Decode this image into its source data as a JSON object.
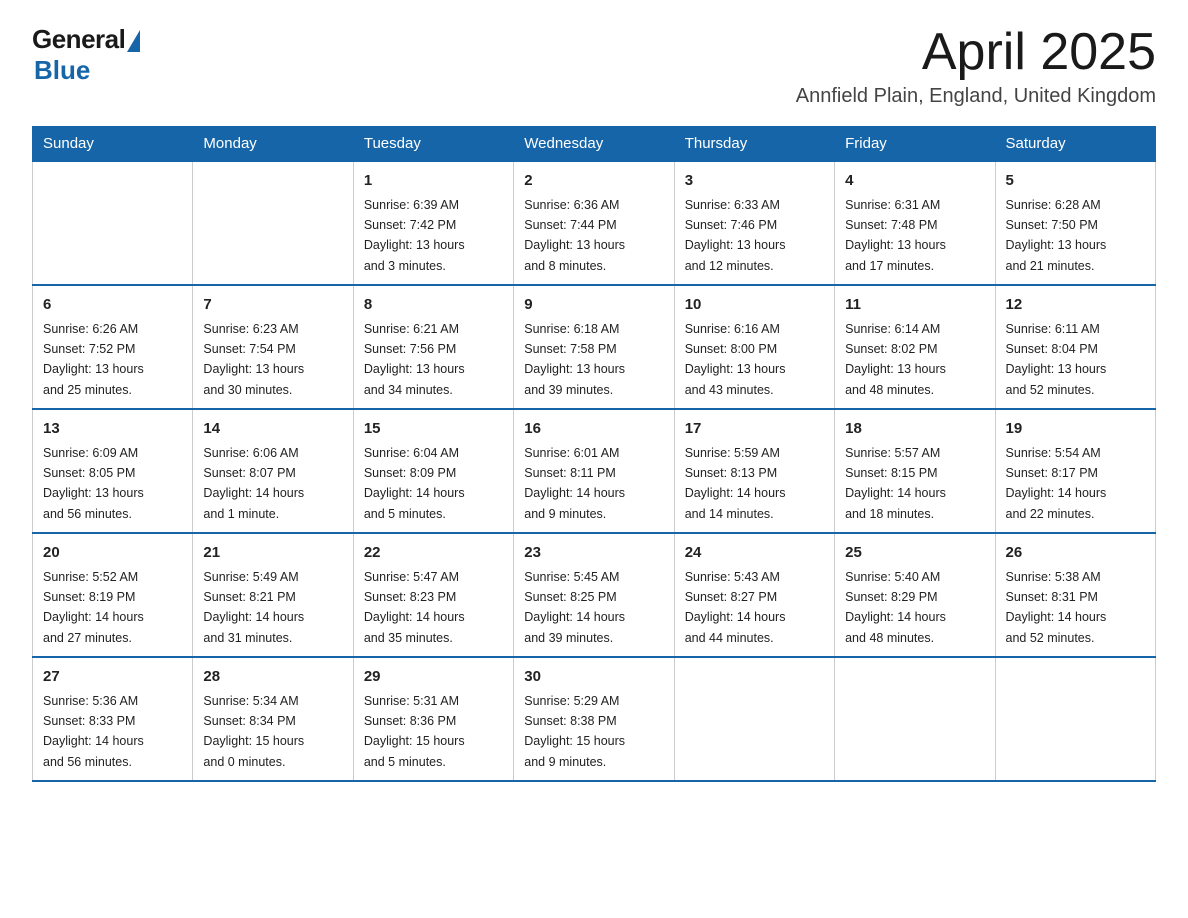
{
  "logo": {
    "general": "General",
    "blue": "Blue"
  },
  "title": "April 2025",
  "subtitle": "Annfield Plain, England, United Kingdom",
  "headers": [
    "Sunday",
    "Monday",
    "Tuesday",
    "Wednesday",
    "Thursday",
    "Friday",
    "Saturday"
  ],
  "weeks": [
    [
      {
        "day": "",
        "info": ""
      },
      {
        "day": "",
        "info": ""
      },
      {
        "day": "1",
        "info": "Sunrise: 6:39 AM\nSunset: 7:42 PM\nDaylight: 13 hours\nand 3 minutes."
      },
      {
        "day": "2",
        "info": "Sunrise: 6:36 AM\nSunset: 7:44 PM\nDaylight: 13 hours\nand 8 minutes."
      },
      {
        "day": "3",
        "info": "Sunrise: 6:33 AM\nSunset: 7:46 PM\nDaylight: 13 hours\nand 12 minutes."
      },
      {
        "day": "4",
        "info": "Sunrise: 6:31 AM\nSunset: 7:48 PM\nDaylight: 13 hours\nand 17 minutes."
      },
      {
        "day": "5",
        "info": "Sunrise: 6:28 AM\nSunset: 7:50 PM\nDaylight: 13 hours\nand 21 minutes."
      }
    ],
    [
      {
        "day": "6",
        "info": "Sunrise: 6:26 AM\nSunset: 7:52 PM\nDaylight: 13 hours\nand 25 minutes."
      },
      {
        "day": "7",
        "info": "Sunrise: 6:23 AM\nSunset: 7:54 PM\nDaylight: 13 hours\nand 30 minutes."
      },
      {
        "day": "8",
        "info": "Sunrise: 6:21 AM\nSunset: 7:56 PM\nDaylight: 13 hours\nand 34 minutes."
      },
      {
        "day": "9",
        "info": "Sunrise: 6:18 AM\nSunset: 7:58 PM\nDaylight: 13 hours\nand 39 minutes."
      },
      {
        "day": "10",
        "info": "Sunrise: 6:16 AM\nSunset: 8:00 PM\nDaylight: 13 hours\nand 43 minutes."
      },
      {
        "day": "11",
        "info": "Sunrise: 6:14 AM\nSunset: 8:02 PM\nDaylight: 13 hours\nand 48 minutes."
      },
      {
        "day": "12",
        "info": "Sunrise: 6:11 AM\nSunset: 8:04 PM\nDaylight: 13 hours\nand 52 minutes."
      }
    ],
    [
      {
        "day": "13",
        "info": "Sunrise: 6:09 AM\nSunset: 8:05 PM\nDaylight: 13 hours\nand 56 minutes."
      },
      {
        "day": "14",
        "info": "Sunrise: 6:06 AM\nSunset: 8:07 PM\nDaylight: 14 hours\nand 1 minute."
      },
      {
        "day": "15",
        "info": "Sunrise: 6:04 AM\nSunset: 8:09 PM\nDaylight: 14 hours\nand 5 minutes."
      },
      {
        "day": "16",
        "info": "Sunrise: 6:01 AM\nSunset: 8:11 PM\nDaylight: 14 hours\nand 9 minutes."
      },
      {
        "day": "17",
        "info": "Sunrise: 5:59 AM\nSunset: 8:13 PM\nDaylight: 14 hours\nand 14 minutes."
      },
      {
        "day": "18",
        "info": "Sunrise: 5:57 AM\nSunset: 8:15 PM\nDaylight: 14 hours\nand 18 minutes."
      },
      {
        "day": "19",
        "info": "Sunrise: 5:54 AM\nSunset: 8:17 PM\nDaylight: 14 hours\nand 22 minutes."
      }
    ],
    [
      {
        "day": "20",
        "info": "Sunrise: 5:52 AM\nSunset: 8:19 PM\nDaylight: 14 hours\nand 27 minutes."
      },
      {
        "day": "21",
        "info": "Sunrise: 5:49 AM\nSunset: 8:21 PM\nDaylight: 14 hours\nand 31 minutes."
      },
      {
        "day": "22",
        "info": "Sunrise: 5:47 AM\nSunset: 8:23 PM\nDaylight: 14 hours\nand 35 minutes."
      },
      {
        "day": "23",
        "info": "Sunrise: 5:45 AM\nSunset: 8:25 PM\nDaylight: 14 hours\nand 39 minutes."
      },
      {
        "day": "24",
        "info": "Sunrise: 5:43 AM\nSunset: 8:27 PM\nDaylight: 14 hours\nand 44 minutes."
      },
      {
        "day": "25",
        "info": "Sunrise: 5:40 AM\nSunset: 8:29 PM\nDaylight: 14 hours\nand 48 minutes."
      },
      {
        "day": "26",
        "info": "Sunrise: 5:38 AM\nSunset: 8:31 PM\nDaylight: 14 hours\nand 52 minutes."
      }
    ],
    [
      {
        "day": "27",
        "info": "Sunrise: 5:36 AM\nSunset: 8:33 PM\nDaylight: 14 hours\nand 56 minutes."
      },
      {
        "day": "28",
        "info": "Sunrise: 5:34 AM\nSunset: 8:34 PM\nDaylight: 15 hours\nand 0 minutes."
      },
      {
        "day": "29",
        "info": "Sunrise: 5:31 AM\nSunset: 8:36 PM\nDaylight: 15 hours\nand 5 minutes."
      },
      {
        "day": "30",
        "info": "Sunrise: 5:29 AM\nSunset: 8:38 PM\nDaylight: 15 hours\nand 9 minutes."
      },
      {
        "day": "",
        "info": ""
      },
      {
        "day": "",
        "info": ""
      },
      {
        "day": "",
        "info": ""
      }
    ]
  ]
}
